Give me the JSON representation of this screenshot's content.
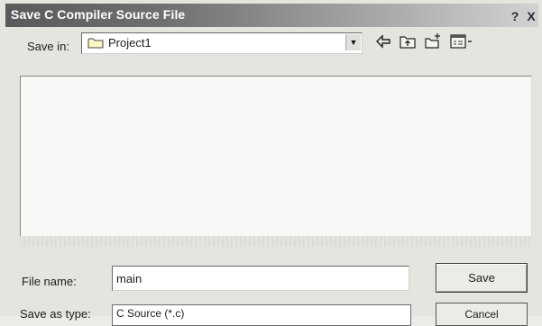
{
  "window": {
    "title": "Save C Compiler Source File",
    "help_label": "?",
    "close_label": "X"
  },
  "save_in": {
    "label": "Save in:",
    "value": "Project1",
    "icons": [
      "folder-icon",
      "back-arrow-icon",
      "up-folder-icon",
      "new-folder-icon",
      "view-menu-icon"
    ]
  },
  "file_list": {
    "items": []
  },
  "file_name": {
    "label": "File name:",
    "value": "main"
  },
  "save_as_type": {
    "label": "Save as type:",
    "value": "C Source (*.c)"
  },
  "buttons": {
    "save_label": "Save",
    "cancel_label": "Cancel"
  }
}
